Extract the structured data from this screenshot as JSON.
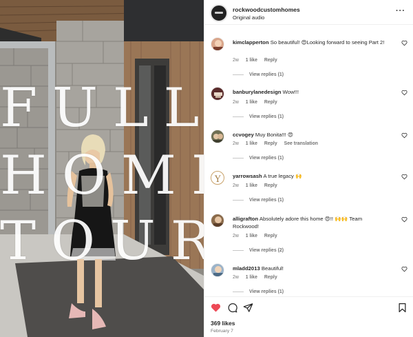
{
  "media": {
    "overlay_lines": [
      "FULL",
      "HOME",
      "TOUR"
    ]
  },
  "header": {
    "account": "rockwoodcustomhomes",
    "audio": "Original audio",
    "more": "···"
  },
  "comments": [
    {
      "user": "kimclapperton",
      "text": "So beautiful! 😍Looking forward to seeing Part 2!",
      "time": "2w",
      "likes": "1 like",
      "reply": "Reply",
      "translation": "",
      "replies": "View replies (1)"
    },
    {
      "user": "banburylanedesign",
      "text": "Wow!!!",
      "time": "2w",
      "likes": "1 like",
      "reply": "Reply",
      "translation": "",
      "replies": "View replies (1)"
    },
    {
      "user": "ccvogey",
      "text": "Muy Bonita!!! 😍",
      "time": "2w",
      "likes": "1 like",
      "reply": "Reply",
      "translation": "See translation",
      "replies": "View replies (1)"
    },
    {
      "user": "yarrowsash",
      "text": "A true legacy 🙌",
      "time": "2w",
      "likes": "1 like",
      "reply": "Reply",
      "translation": "",
      "replies": "View replies (1)"
    },
    {
      "user": "alligrafton",
      "text": "Absolutely adore this home 😍!! 🙌🙌 Team Rockwood!",
      "time": "2w",
      "likes": "1 like",
      "reply": "Reply",
      "translation": "",
      "replies": "View replies (2)"
    },
    {
      "user": "mladd2013",
      "text": "Beautiful!",
      "time": "2w",
      "likes": "1 like",
      "reply": "Reply",
      "translation": "",
      "replies": "View replies (1)"
    }
  ],
  "footer": {
    "likes": "369 likes",
    "date": "February 7"
  },
  "colors": {
    "like_red": "#ed4956",
    "muted": "#737373",
    "text": "#262626"
  },
  "icons": {
    "like": "heart-icon",
    "comment": "comment-icon",
    "share": "share-icon",
    "save": "bookmark-icon"
  }
}
